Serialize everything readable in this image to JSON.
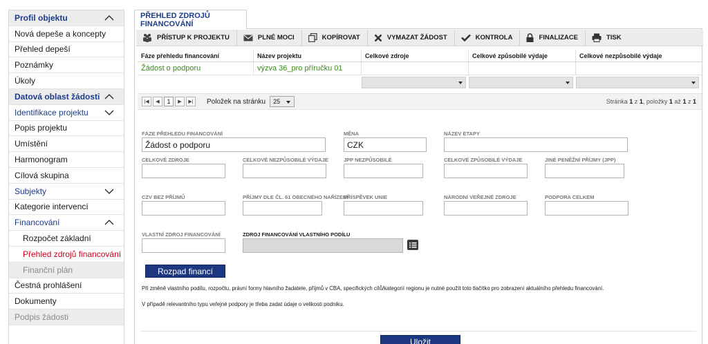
{
  "sidebar": {
    "items": [
      {
        "label": "Profil objektu",
        "type": "header",
        "chevron": "up"
      },
      {
        "label": "Nová depeše a koncepty",
        "type": "item"
      },
      {
        "label": "Přehled depeší",
        "type": "item"
      },
      {
        "label": "Poznámky",
        "type": "item"
      },
      {
        "label": "Úkoly",
        "type": "item"
      },
      {
        "label": "Datová oblast žádosti",
        "type": "header",
        "chevron": "up"
      },
      {
        "label": "Identifikace projektu",
        "type": "section",
        "chevron": "down"
      },
      {
        "label": "Popis projektu",
        "type": "item"
      },
      {
        "label": "Umístění",
        "type": "item"
      },
      {
        "label": "Harmonogram",
        "type": "item"
      },
      {
        "label": "Cílová skupina",
        "type": "item"
      },
      {
        "label": "Subjekty",
        "type": "section",
        "chevron": "down"
      },
      {
        "label": "Kategorie intervencí",
        "type": "item"
      },
      {
        "label": "Financování",
        "type": "section",
        "chevron": "up"
      },
      {
        "label": "Rozpočet základní",
        "type": "sub"
      },
      {
        "label": "Přehled zdrojů financování",
        "type": "sub-active"
      },
      {
        "label": "Finanční plán",
        "type": "sub-disabled"
      },
      {
        "label": "Čestná prohlášení",
        "type": "item"
      },
      {
        "label": "Dokumenty",
        "type": "item"
      },
      {
        "label": "Podpis žádosti",
        "type": "disabled"
      }
    ]
  },
  "tab": {
    "label": "PŘEHLED ZDROJŮ FINANCOVÁNÍ"
  },
  "toolbar": {
    "buttons": [
      {
        "label": "PŘÍSTUP K PROJEKTU",
        "icon": "people-icon"
      },
      {
        "label": "PLNÉ MOCI",
        "icon": "envelope-icon"
      },
      {
        "label": "KOPÍROVAT",
        "icon": "copy-icon"
      },
      {
        "label": "VYMAZAT ŽÁDOST",
        "icon": "cross-icon"
      },
      {
        "label": "KONTROLA",
        "icon": "check-icon"
      },
      {
        "label": "FINALIZACE",
        "icon": "lock-icon"
      },
      {
        "label": "TISK",
        "icon": "printer-icon"
      }
    ]
  },
  "grid": {
    "headers": [
      "Fáze přehledu financování",
      "Název projektu",
      "Celkové zdroje",
      "Celkové způsobilé výdaje",
      "Celkové nezpůsobilé výdaje"
    ],
    "row": [
      "Žádost o podporu",
      "výzva 36_pro příručku 01",
      "",
      "",
      ""
    ]
  },
  "pager": {
    "page": "1",
    "per_page_label": "Položek na stránku",
    "per_page": "25",
    "info_prefix": "Stránka",
    "info_page": "1",
    "info_of": "z",
    "info_pages": "1",
    "info_items": ", položky",
    "info_from": "1",
    "info_to_word": "až",
    "info_to": "1",
    "info_z2": "z",
    "info_total": "1"
  },
  "form": {
    "faze_label": "FÁZE PŘEHLEDU FINANCOVÁNÍ",
    "faze_value": "Žádost o podporu",
    "mena_label": "MĚNA",
    "mena_value": "CZK",
    "nazev_etapy_label": "NÁZEV ETAPY",
    "celkove_zdroje_label": "CELKOVÉ ZDROJE",
    "celkove_nezpusobile_label": "CELKOVÉ NEZPŮSOBILÉ VÝDAJE",
    "jpp_nezpusobile_label": "JPP NEZPŮSOBILÉ",
    "celkove_zpusobile_label": "CELKOVÉ ZPŮSOBILÉ VÝDAJE",
    "jine_penezni_label": "JINÉ PENĚŽNÍ PŘÍJMY (JPP)",
    "czv_label": "CZV BEZ PŘÍJMŮ",
    "prijmy_label": "PŘÍJMY DLE ČL. 61 OBECNÉHO NAŘÍZENÍ",
    "prispevek_label": "PŘÍSPĚVEK UNIE",
    "narodni_label": "NÁRODNÍ VEŘEJNÉ ZDROJE",
    "podpora_label": "PODPORA CELKEM",
    "vlastni_label": "VLASTNÍ ZDROJ FINANCOVÁNÍ",
    "zdroj_vlastniho_label": "ZDROJ FINANCOVÁNÍ VLASTNÍHO PODÍLU"
  },
  "actions": {
    "rozpad_label": "Rozpad financí",
    "save_label": "Uložit"
  },
  "notes": {
    "note1": "Při změně vlastního podílu, rozpočtu, právní formy hlavního žadatele, příjmů v CBA, specifických cílů/kategorií regionu je nutné použít toto tlačítko pro zobrazení aktuálního přehledu financování.",
    "note2": "V případě relevantního typu veřejné podpory je třeba zadat údaje o velikosti podniku."
  },
  "colors": {
    "brand": "#1c3780",
    "active": "#d0021b",
    "link_green": "#3a8a1a"
  }
}
